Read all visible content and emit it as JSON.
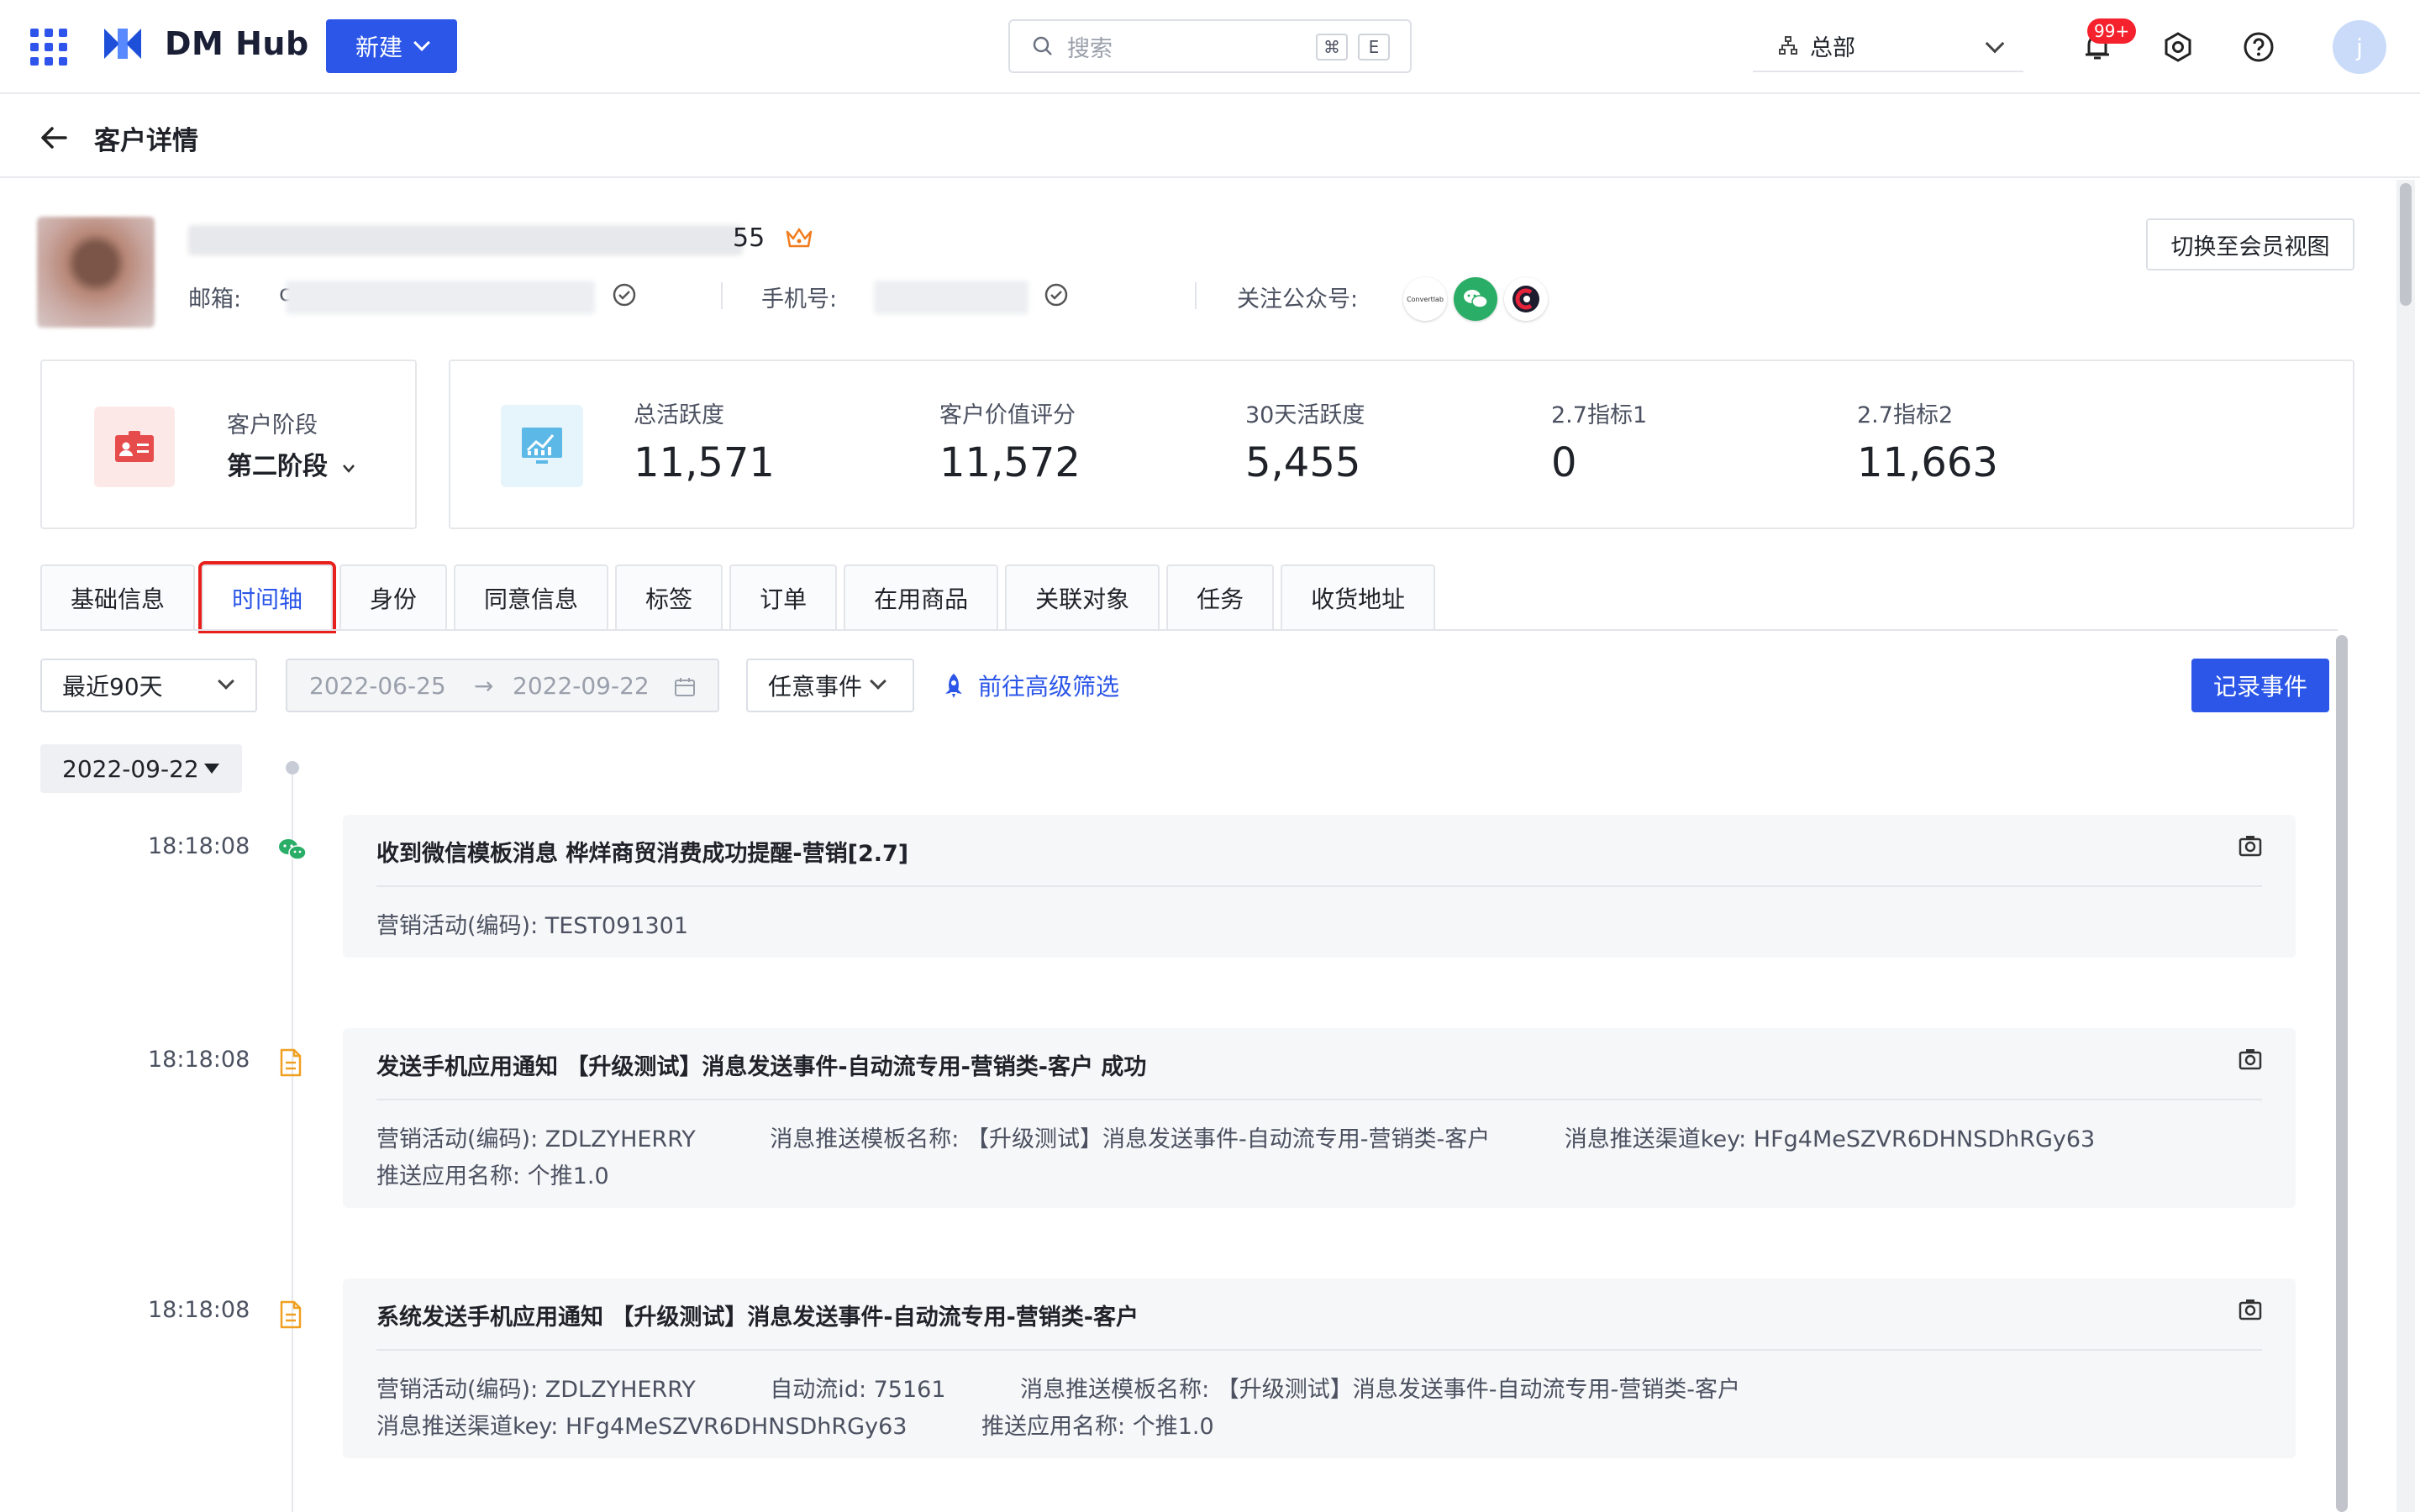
{
  "topbar": {
    "brand": "DM Hub",
    "new_label": "新建",
    "search_placeholder": "搜索",
    "search_kbd_1": "⌘",
    "search_kbd_2": "E",
    "org_label": "总部",
    "notif_count": "99+",
    "avatar_initial": "j"
  },
  "page": {
    "title": "客户详情"
  },
  "profile": {
    "name_suffix": "55",
    "email_label": "邮箱:",
    "email_visible_char": "c",
    "phone_label": "手机号:",
    "follow_label": "关注公众号:",
    "followed_accounts": [
      "Convertlab",
      "wechat",
      "C"
    ],
    "switch_button": "切换至会员视图"
  },
  "stage": {
    "label": "客户阶段",
    "value": "第二阶段"
  },
  "metrics": [
    {
      "label": "总活跃度",
      "value": "11,571"
    },
    {
      "label": "客户价值评分",
      "value": "11,572"
    },
    {
      "label": "30天活跃度",
      "value": "5,455"
    },
    {
      "label": "2.7指标1",
      "value": "0"
    },
    {
      "label": "2.7指标2",
      "value": "11,663"
    }
  ],
  "tabs": [
    "基础信息",
    "时间轴",
    "身份",
    "同意信息",
    "标签",
    "订单",
    "在用商品",
    "关联对象",
    "任务",
    "收货地址"
  ],
  "active_tab": "时间轴",
  "filters": {
    "period": "最近90天",
    "date_start": "2022-06-25",
    "date_arrow": "→",
    "date_end": "2022-09-22",
    "event_type": "任意事件",
    "advanced": "前往高级筛选",
    "record_button": "记录事件"
  },
  "timeline": {
    "date": "2022-09-22",
    "events": [
      {
        "time": "18:18:08",
        "icon": "wechat-icon",
        "title": "收到微信模板消息 桦烊商贸消费成功提醒-营销[2.7]",
        "rows": [
          [
            "营销活动(编码):  TEST091301"
          ]
        ]
      },
      {
        "time": "18:18:08",
        "icon": "document-icon",
        "title": "发送手机应用通知 【升级测试】消息发送事件-自动流专用-营销类-客户 成功",
        "rows": [
          [
            "营销活动(编码):  ZDLZYHERRY",
            "消息推送模板名称:  【升级测试】消息发送事件-自动流专用-营销类-客户",
            "消息推送渠道key:  HFg4MeSZVR6DHNSDhRGy63"
          ],
          [
            "推送应用名称:  个推1.0"
          ]
        ]
      },
      {
        "time": "18:18:08",
        "icon": "document-icon",
        "title": "系统发送手机应用通知 【升级测试】消息发送事件-自动流专用-营销类-客户",
        "rows": [
          [
            "营销活动(编码):  ZDLZYHERRY",
            "自动流id:  75161",
            "消息推送模板名称:  【升级测试】消息发送事件-自动流专用-营销类-客户"
          ],
          [
            "消息推送渠道key:  HFg4MeSZVR6DHNSDhRGy63",
            "推送应用名称:  个推1.0"
          ]
        ]
      }
    ]
  },
  "colors": {
    "primary": "#2b56e8",
    "danger": "#f5222d",
    "highlight": "#e8201c"
  }
}
